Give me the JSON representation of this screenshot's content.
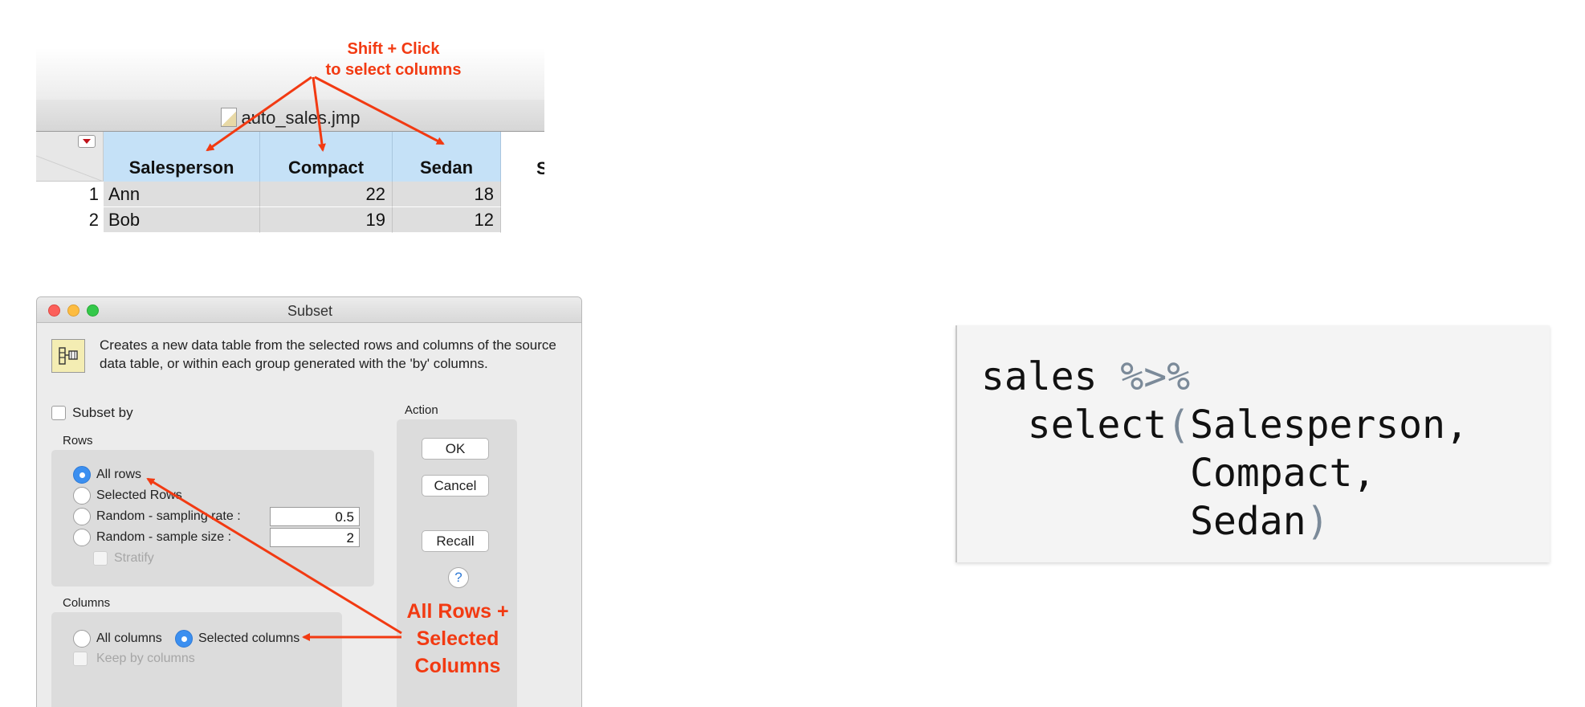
{
  "table_window": {
    "title": "auto_sales.jmp",
    "columns": [
      "Salesperson",
      "Compact",
      "Sedan"
    ],
    "partial_next_column": "S",
    "rows": [
      {
        "num": "1",
        "Salesperson": "Ann",
        "Compact": "22",
        "Sedan": "18"
      },
      {
        "num": "2",
        "Salesperson": "Bob",
        "Compact": "19",
        "Sedan": "12"
      }
    ]
  },
  "annotations": {
    "top_line1": "Shift + Click",
    "top_line2": "to select columns",
    "bottom_line1": "All Rows +",
    "bottom_line2": "Selected",
    "bottom_line3": "Columns",
    "color": "#f23a12"
  },
  "subset_dialog": {
    "title": "Subset",
    "description": "Creates a new data table from the selected rows and columns of the source data table, or within each group generated with the 'by' columns.",
    "subset_by_label": "Subset by",
    "subset_by_checked": false,
    "action_label": "Action",
    "rows_label": "Rows",
    "rows_options": [
      {
        "label": "All rows",
        "selected": true
      },
      {
        "label": "Selected Rows",
        "selected": false
      },
      {
        "label": "Random - sampling rate :",
        "selected": false,
        "value": "0.5"
      },
      {
        "label": "Random - sample size :",
        "selected": false,
        "value": "2"
      }
    ],
    "stratify_label": "Stratify",
    "columns_label": "Columns",
    "columns_options": [
      {
        "label": "All columns",
        "selected": false
      },
      {
        "label": "Selected columns",
        "selected": true
      }
    ],
    "keep_by_columns_label": "Keep by columns",
    "buttons": {
      "ok": "OK",
      "cancel": "Cancel",
      "recall": "Recall",
      "help": "?"
    }
  },
  "code": {
    "line1_word": "sales",
    "line1_op": "%>%",
    "line2_fn": "select",
    "open_paren": "(",
    "arg1": "Salesperson,",
    "arg2": "Compact,",
    "arg3": "Sedan",
    "close_paren": ")"
  }
}
